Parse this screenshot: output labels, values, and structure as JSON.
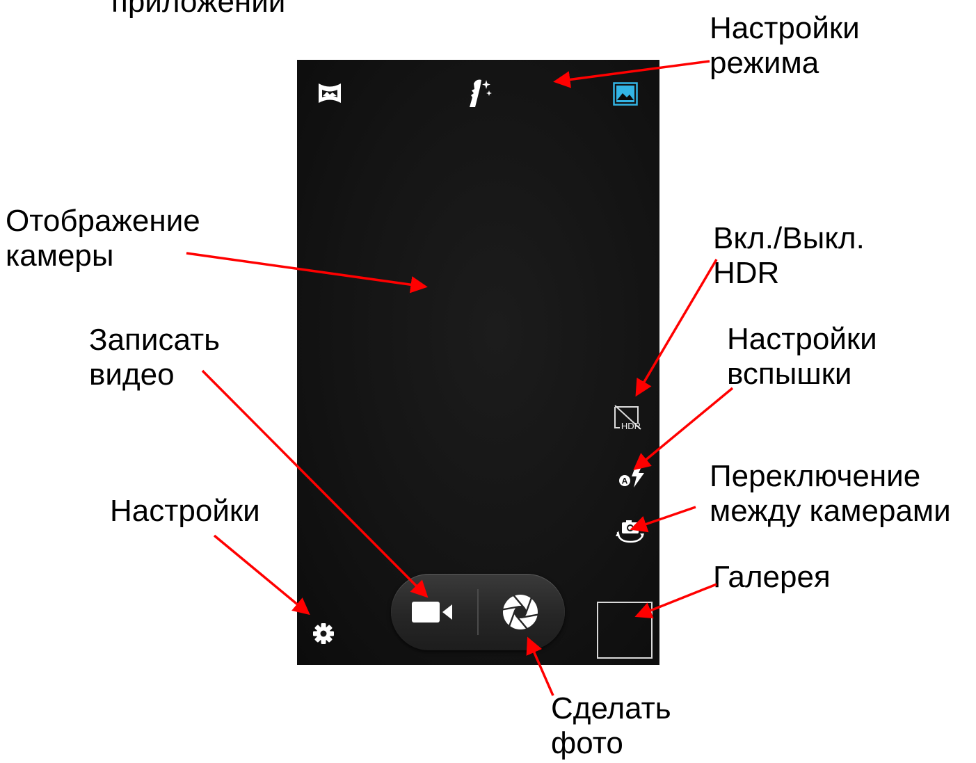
{
  "annotations": {
    "top_left": "приложений",
    "mode_settings": "Настройки\nрежима",
    "camera_view": "Отображение\nкамеры",
    "hdr_toggle": "Вкл./Выкл.\nHDR",
    "record_video": "Записать\nвидео",
    "flash_settings": "Настройки\nвспышки",
    "switch_cameras": "Переключение\nмежду камерами",
    "settings": "Настройки",
    "gallery": "Галерея",
    "take_photo": "Сделать\nфото"
  },
  "camera_ui": {
    "top_icons": [
      "panorama-icon",
      "beauty-face-icon",
      "scene-mode-icon"
    ],
    "side_icons": [
      "hdr-off-icon",
      "flash-auto-icon",
      "switch-camera-icon"
    ],
    "bottom_controls": [
      "settings-gear-icon",
      "video-record-button",
      "shutter-button",
      "gallery-thumbnail"
    ],
    "hdr_badge": "HDR",
    "flash_badge": "A"
  },
  "colors": {
    "arrow": "#ff0000",
    "accent": "#33b5e5",
    "icon": "#ffffff",
    "background": "#111111"
  }
}
